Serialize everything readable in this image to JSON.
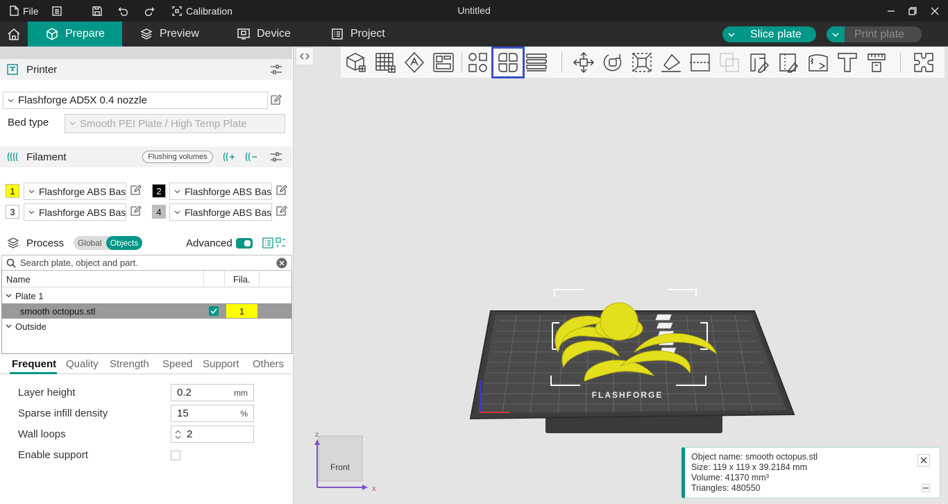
{
  "titlebar": {
    "file_label": "File",
    "calibration_label": "Calibration",
    "doc_title": "Untitled"
  },
  "nav": {
    "tabs": [
      {
        "label": "Prepare",
        "icon": "cube-icon",
        "active": true
      },
      {
        "label": "Preview",
        "icon": "layers-icon",
        "active": false
      },
      {
        "label": "Device",
        "icon": "monitor-icon",
        "active": false
      },
      {
        "label": "Project",
        "icon": "list-icon",
        "active": false
      }
    ],
    "slice_label": "Slice plate",
    "print_label": "Print plate"
  },
  "printer": {
    "section_title": "Printer",
    "name": "Flashforge AD5X 0.4 nozzle",
    "bed_type_label": "Bed type",
    "bed_type_value": "Smooth PEI Plate / High Temp Plate"
  },
  "filament": {
    "section_title": "Filament",
    "flushing_label": "Flushing volumes",
    "items": [
      {
        "num": "1",
        "name": "Flashforge ABS Basic",
        "color": "#ffff00",
        "text_color": "#111111"
      },
      {
        "num": "2",
        "name": "Flashforge ABS Basic",
        "color": "#000000",
        "text_color": "#ffffff"
      },
      {
        "num": "3",
        "name": "Flashforge ABS Basic",
        "color": "#ffffff",
        "text_color": "#111111"
      },
      {
        "num": "4",
        "name": "Flashforge ABS Basic",
        "color": "#bdbdbd",
        "text_color": "#111111"
      }
    ]
  },
  "process": {
    "section_title": "Process",
    "global_label": "Global",
    "objects_label": "Objects",
    "advanced_label": "Advanced",
    "search_placeholder": "Search plate, object and part.",
    "tree": {
      "col_name": "Name",
      "col_fila": "Fila.",
      "plate": "Plate 1",
      "object": "smooth octopus.stl",
      "object_fila": "1",
      "outside": "Outside"
    },
    "tabs": [
      "Frequent",
      "Quality",
      "Strength",
      "Speed",
      "Support",
      "Others"
    ],
    "params": {
      "layer_height_label": "Layer height",
      "layer_height_value": "0.2",
      "layer_height_unit": "mm",
      "infill_label": "Sparse infill density",
      "infill_value": "15",
      "infill_unit": "%",
      "wall_loops_label": "Wall loops",
      "wall_loops_value": "2",
      "enable_support_label": "Enable support"
    }
  },
  "viewport": {
    "bed_brand": "FLASHFORGE",
    "view_cube_label": "Front",
    "axis_x": "x",
    "axis_z": "z"
  },
  "info": {
    "object_name": "Object name: smooth octopus.stl",
    "size": "Size: 119 x 119 x 39.2184 mm",
    "volume": "Volume: 41370 mm³",
    "triangles": "Triangles: 480550"
  },
  "colors": {
    "accent": "#009688",
    "highlight": "#3a4fc9",
    "model": "#e3df1c"
  }
}
